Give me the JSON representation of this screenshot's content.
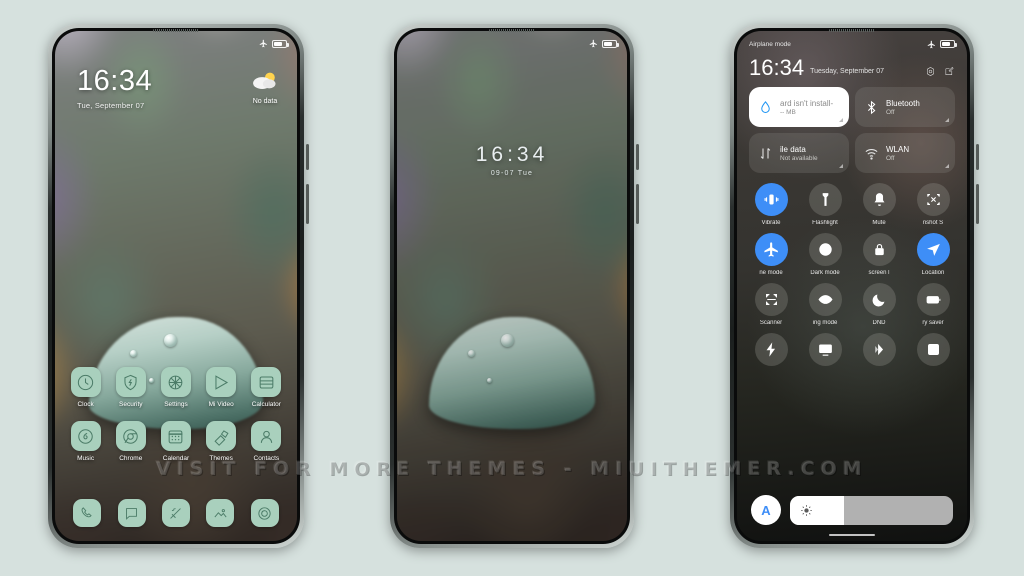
{
  "background_color": "#d6e1de",
  "watermark": {
    "text": "VISIT FOR MORE THEMES  -  MIUITHEMER.COM"
  },
  "phone1": {
    "name": "lockscreen-homescreen",
    "statusbar": {
      "airplane_icon": "airplane-icon",
      "battery_icon": "battery-icon"
    },
    "clock": {
      "time": "16:34",
      "date": "Tue, September 07"
    },
    "weather": {
      "icon": "partly-cloudy-icon",
      "text": "No data"
    },
    "apps_row1": [
      {
        "label": "Clock",
        "icon": "clock-icon"
      },
      {
        "label": "Security",
        "icon": "shield-icon"
      },
      {
        "label": "Settings",
        "icon": "settings-gear-icon"
      },
      {
        "label": "Mi Video",
        "icon": "play-icon"
      },
      {
        "label": "Calculator",
        "icon": "calculator-icon"
      }
    ],
    "apps_row2": [
      {
        "label": "Music",
        "icon": "music-note-icon"
      },
      {
        "label": "Chrome",
        "icon": "chrome-icon"
      },
      {
        "label": "Calendar",
        "icon": "calendar-icon"
      },
      {
        "label": "Themes",
        "icon": "themes-brush-icon"
      },
      {
        "label": "Contacts",
        "icon": "contacts-person-icon"
      }
    ],
    "dock": [
      {
        "label": "Phone",
        "icon": "phone-handset-icon"
      },
      {
        "label": "Messages",
        "icon": "message-bubble-icon"
      },
      {
        "label": "Notes",
        "icon": "notes-pen-icon"
      },
      {
        "label": "Gallery",
        "icon": "gallery-mountain-icon"
      },
      {
        "label": "Camera",
        "icon": "camera-icon"
      }
    ]
  },
  "phone2": {
    "name": "lockscreen-centered",
    "statusbar": {
      "airplane_icon": "airplane-icon",
      "battery_icon": "battery-icon"
    },
    "clock": {
      "time": "16:34",
      "date": "09-07 Tue"
    }
  },
  "phone3": {
    "name": "notification-shade",
    "statusbar": {
      "airplane_label": "Airplane mode",
      "airplane_icon": "airplane-icon",
      "battery_icon": "battery-icon"
    },
    "header": {
      "time": "16:34",
      "date": "Tuesday, September 07",
      "settings_icon": "settings-gear-icon",
      "edit_icon": "edit-pencil-icon"
    },
    "big_tiles": [
      {
        "title": "ard isn't install-",
        "subtitle": "-- MB",
        "icon": "water-drop-icon",
        "style": "white",
        "accent": "#2196f3"
      },
      {
        "title": "Bluetooth",
        "subtitle": "Off",
        "icon": "bluetooth-icon",
        "style": "dark",
        "accent": "#ffffff"
      },
      {
        "title": "ile data",
        "subtitle": "Not available",
        "icon": "mobile-data-icon",
        "style": "dark",
        "accent": "#ffffff"
      },
      {
        "title": "WLAN",
        "subtitle": "Off",
        "icon": "wifi-icon",
        "style": "dark",
        "accent": "#ffffff"
      }
    ],
    "toggle_rows": [
      [
        {
          "label": "Vibrate",
          "icon": "vibrate-icon",
          "on": true
        },
        {
          "label": "Flashlight",
          "icon": "flashlight-icon",
          "on": false
        },
        {
          "label": "Mute",
          "icon": "bell-icon",
          "on": false
        },
        {
          "label": "nshot       S",
          "icon": "screenshot-icon",
          "on": false
        }
      ],
      [
        {
          "label": "ne mode",
          "icon": "airplane-icon",
          "on": true
        },
        {
          "label": "Dark mode",
          "icon": "contrast-icon",
          "on": false
        },
        {
          "label": "screen        l",
          "icon": "lock-icon",
          "on": false
        },
        {
          "label": "Location",
          "icon": "location-arrow-icon",
          "on": true
        }
      ],
      [
        {
          "label": "Scanner",
          "icon": "scanner-icon",
          "on": false
        },
        {
          "label": "ing mode",
          "icon": "eye-icon",
          "on": false
        },
        {
          "label": "DND",
          "icon": "moon-icon",
          "on": false
        },
        {
          "label": "ry saver",
          "icon": "battery-saver-icon",
          "on": false
        }
      ],
      [
        {
          "label": "",
          "icon": "lightning-icon",
          "on": false
        },
        {
          "label": "",
          "icon": "cast-screen-icon",
          "on": false
        },
        {
          "label": "",
          "icon": "reading-contrast-icon",
          "on": false
        },
        {
          "label": "",
          "icon": "expand-screenshot-icon",
          "on": false
        }
      ]
    ],
    "brightness": {
      "auto_label": "A",
      "icon": "brightness-sun-icon",
      "level_percent": 33
    }
  },
  "accent_colors": {
    "toggle_on": "#3e8ef7",
    "icon_tint": "#4c7c68",
    "app_tile": "#a9d0bd"
  }
}
